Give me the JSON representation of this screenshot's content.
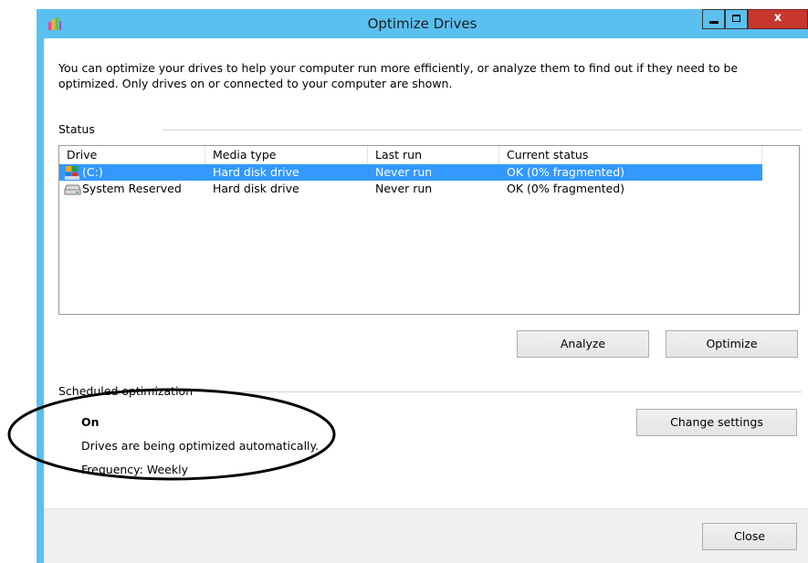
{
  "window": {
    "title": "Optimize Drives",
    "minimize_glyph": "",
    "maximize_glyph": "",
    "close_glyph": "x"
  },
  "intro_text": "You can optimize your drives to help your computer run more efficiently, or analyze them to find out if they need to be optimized. Only drives on or connected to your computer are shown.",
  "status": {
    "label": "Status",
    "columns": [
      "Drive",
      "Media type",
      "Last run",
      "Current status"
    ],
    "rows": [
      {
        "drive": "(C:)",
        "media_type": "Hard disk drive",
        "last_run": "Never run",
        "current_status": "OK (0% fragmented)",
        "selected": true,
        "icon": "windows-drive-icon"
      },
      {
        "drive": "System Reserved",
        "media_type": "Hard disk drive",
        "last_run": "Never run",
        "current_status": "OK (0% fragmented)",
        "selected": false,
        "icon": "hard-drive-icon"
      }
    ]
  },
  "buttons": {
    "analyze": "Analyze",
    "optimize": "Optimize",
    "change_settings": "Change settings",
    "close": "Close"
  },
  "scheduled": {
    "label": "Scheduled optimization",
    "state": "On",
    "description": "Drives are being optimized automatically.",
    "frequency": "Frequency: Weekly"
  },
  "colors": {
    "title_bar": "#5ac0f0",
    "selection": "#3399ff",
    "close_button": "#c7372d"
  }
}
